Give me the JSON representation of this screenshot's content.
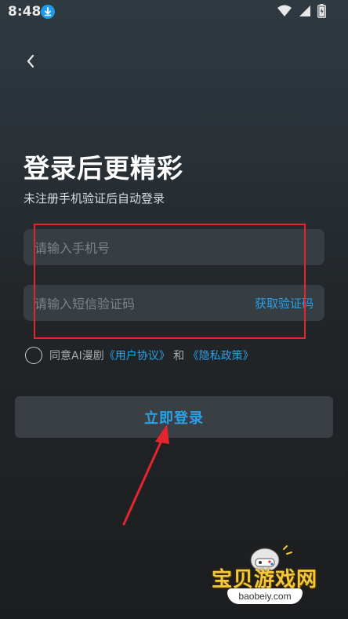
{
  "status_bar": {
    "time": "8:48",
    "icons": [
      "download-icon",
      "wifi-icon",
      "signal-icon",
      "battery-icon"
    ]
  },
  "header": {
    "back_icon": "chevron-left-icon"
  },
  "login": {
    "title": "登录后更精彩",
    "subtitle": "未注册手机验证后自动登录",
    "phone": {
      "placeholder": "请输入手机号",
      "value": ""
    },
    "sms": {
      "placeholder": "请输入短信验证码",
      "value": "",
      "get_code_label": "获取验证码"
    },
    "agreement": {
      "prefix": "同意AI漫剧",
      "user_agreement": "《用户协议》",
      "joiner": "和",
      "privacy_policy": "《隐私政策》",
      "checked": false
    },
    "submit_label": "立即登录"
  },
  "watermark": {
    "name": "宝贝游戏网",
    "url": "baobeiy.com"
  },
  "colors": {
    "accent": "#2aa1e6",
    "annotation": "#e3262d",
    "field_bg": "#363d43",
    "button_bg": "#3a3f45"
  }
}
